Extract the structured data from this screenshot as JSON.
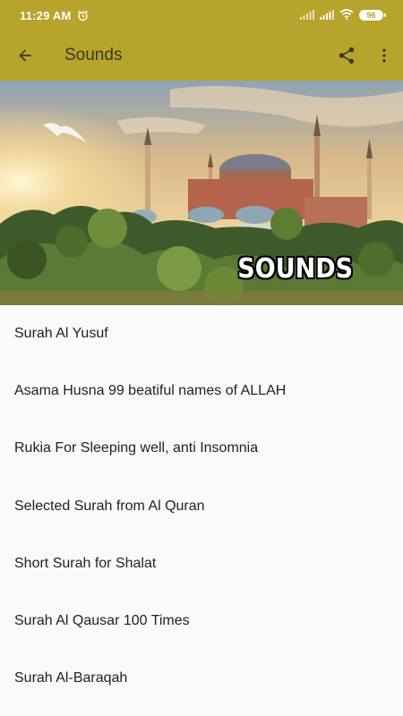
{
  "status_bar": {
    "time": "11:29 AM",
    "battery": "96",
    "icons": [
      "alarm-icon",
      "signal-icon",
      "signal-icon",
      "wifi-icon",
      "battery-icon"
    ]
  },
  "app_bar": {
    "title": "Sounds",
    "back_icon": "arrow-back-icon",
    "share_icon": "share-icon",
    "menu_icon": "more-vert-icon"
  },
  "banner": {
    "caption": "SOUNDS"
  },
  "sounds": [
    "Surah Al Yusuf",
    "Asama Husna 99 beatiful names of ALLAH",
    "Rukia For Sleeping well, anti Insomnia",
    "Selected Surah from Al Quran",
    "Short Surah for Shalat",
    "Surah Al Qausar 100 Times",
    "Surah Al-Baraqah"
  ],
  "colors": {
    "toolbar": "#b7a42c",
    "background": "#fafafa",
    "text": "#222222"
  }
}
